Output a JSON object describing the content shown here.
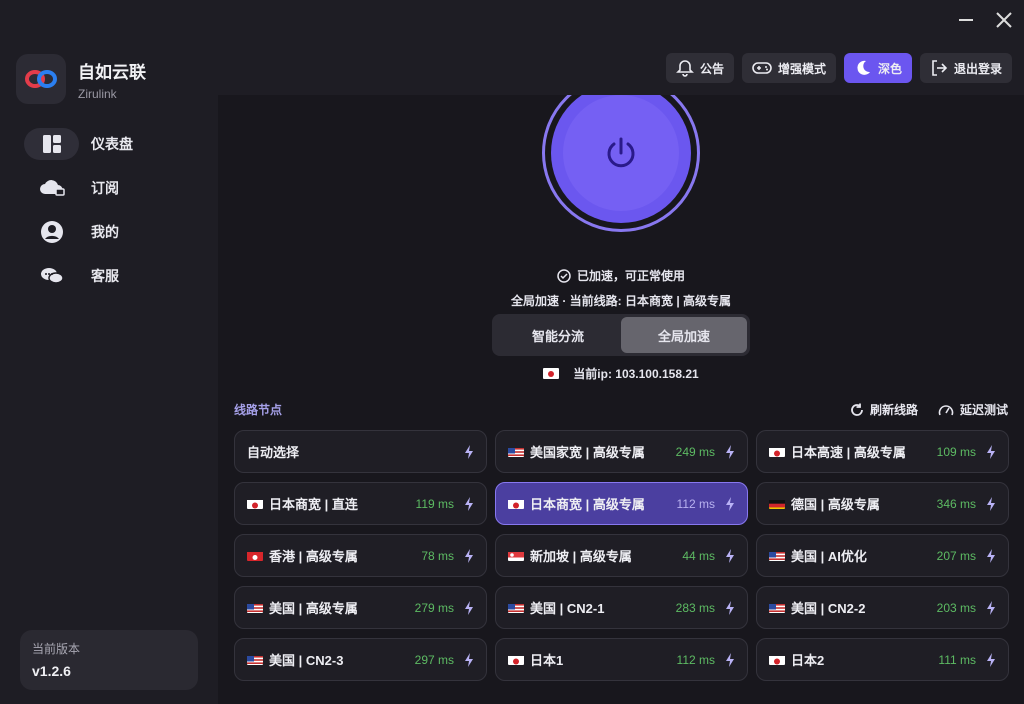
{
  "app": {
    "name": "自如云联",
    "subtitle": "Zirulink"
  },
  "colors": {
    "accent": "#6b56f0",
    "latency_good": "#5dbb63"
  },
  "nav": [
    {
      "label": "仪表盘",
      "icon": "dashboard-icon",
      "active": true
    },
    {
      "label": "订阅",
      "icon": "cloud-cart-icon",
      "active": false
    },
    {
      "label": "我的",
      "icon": "user-icon",
      "active": false
    },
    {
      "label": "客服",
      "icon": "chat-icon",
      "active": false
    }
  ],
  "version": {
    "label": "当前版本",
    "value": "v1.2.6"
  },
  "header": {
    "notice": "公告",
    "enhanced": "增强模式",
    "theme": "深色",
    "logout": "退出登录"
  },
  "status": {
    "connected": "已加速，可正常使用",
    "detail": "全局加速 · 当前线路: 日本商宽 | 高级专属"
  },
  "mode": {
    "smart": "智能分流",
    "global": "全局加速",
    "selected": "全局加速"
  },
  "ip": {
    "label": "当前ip: 103.100.158.21",
    "flag": "jp"
  },
  "nodes_section": {
    "title": "线路节点",
    "refresh": "刷新线路",
    "latency_test": "延迟测试"
  },
  "nodes": [
    {
      "name": "自动选择",
      "flag": "",
      "ms": ""
    },
    {
      "name": "美国家宽 | 高级专属",
      "flag": "us",
      "ms": "249 ms"
    },
    {
      "name": "日本高速 | 高级专属",
      "flag": "jp",
      "ms": "109 ms"
    },
    {
      "name": "日本商宽 | 直连",
      "flag": "jp",
      "ms": "119 ms"
    },
    {
      "name": "日本商宽 | 高级专属",
      "flag": "jp",
      "ms": "112 ms",
      "selected": true
    },
    {
      "name": "德国 | 高级专属",
      "flag": "de",
      "ms": "346 ms"
    },
    {
      "name": "香港 | 高级专属",
      "flag": "hk",
      "ms": "78 ms"
    },
    {
      "name": "新加坡 | 高级专属",
      "flag": "sg",
      "ms": "44 ms"
    },
    {
      "name": "美国 | AI优化",
      "flag": "us",
      "ms": "207 ms"
    },
    {
      "name": "美国 | 高级专属",
      "flag": "us",
      "ms": "279 ms"
    },
    {
      "name": "美国 | CN2-1",
      "flag": "us",
      "ms": "283 ms"
    },
    {
      "name": "美国 | CN2-2",
      "flag": "us",
      "ms": "203 ms"
    },
    {
      "name": "美国 | CN2-3",
      "flag": "us",
      "ms": "297 ms"
    },
    {
      "name": "日本1",
      "flag": "jp",
      "ms": "112 ms"
    },
    {
      "name": "日本2",
      "flag": "jp",
      "ms": "111 ms"
    }
  ]
}
